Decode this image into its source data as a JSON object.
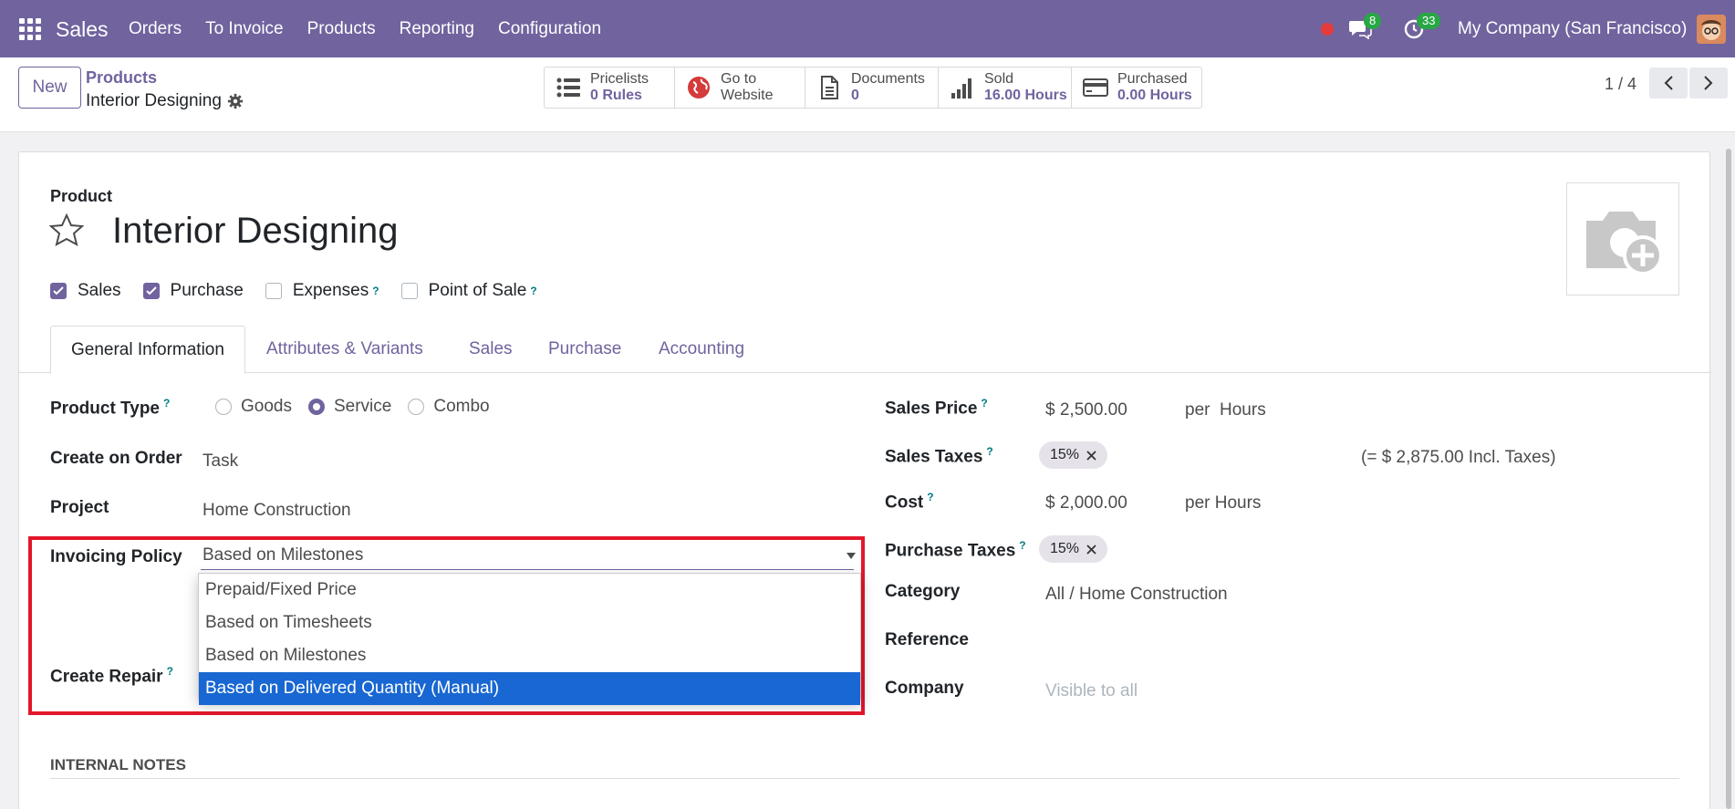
{
  "nav": {
    "app_name": "Sales",
    "menu": [
      "Orders",
      "To Invoice",
      "Products",
      "Reporting",
      "Configuration"
    ],
    "messages_count": "8",
    "activities_count": "33",
    "company": "My Company (San Francisco)"
  },
  "control": {
    "new_label": "New",
    "breadcrumb_parent": "Products",
    "breadcrumb_current": "Interior Designing",
    "smart_buttons": [
      {
        "label": "Pricelists",
        "value": "0 Rules",
        "icon": "list-icon"
      },
      {
        "label": "Go to",
        "value": "Website",
        "icon": "globe-icon"
      },
      {
        "label": "Documents",
        "value": "0",
        "icon": "document-icon"
      },
      {
        "label": "Sold",
        "value": "16.00 Hours",
        "icon": "bar-chart-icon"
      },
      {
        "label": "Purchased",
        "value": "0.00 Hours",
        "icon": "credit-card-icon"
      }
    ],
    "pager": "1 / 4"
  },
  "form": {
    "product_label": "Product",
    "name": "Interior Designing",
    "checkboxes": [
      {
        "label": "Sales",
        "checked": true,
        "help": false
      },
      {
        "label": "Purchase",
        "checked": true,
        "help": false
      },
      {
        "label": "Expenses",
        "checked": false,
        "help": true
      },
      {
        "label": "Point of Sale",
        "checked": false,
        "help": true
      }
    ],
    "tabs": [
      "General Information",
      "Attributes & Variants",
      "Sales",
      "Purchase",
      "Accounting"
    ],
    "left": {
      "product_type_label": "Product Type",
      "product_type_options": [
        "Goods",
        "Service",
        "Combo"
      ],
      "product_type_selected": "Service",
      "create_on_order_label": "Create on Order",
      "create_on_order_value": "Task",
      "project_label": "Project",
      "project_value": "Home Construction",
      "invoicing_policy_label": "Invoicing Policy",
      "invoicing_policy_value": "Based on Milestones",
      "invoicing_policy_options": [
        "Prepaid/Fixed Price",
        "Based on Timesheets",
        "Based on Milestones",
        "Based on Delivered Quantity (Manual)"
      ],
      "invoicing_policy_highlighted": "Based on Delivered Quantity (Manual)",
      "create_repair_label": "Create Repair"
    },
    "right": {
      "sales_price_label": "Sales Price",
      "sales_price_value": "$ 2,500.00",
      "sales_price_uom": "per  Hours",
      "sales_taxes_label": "Sales Taxes",
      "sales_tax_tag": "15%",
      "incl_taxes": "(= $ 2,875.00 Incl. Taxes)",
      "cost_label": "Cost",
      "cost_value": "$ 2,000.00",
      "cost_uom": "per Hours",
      "purchase_taxes_label": "Purchase Taxes",
      "purchase_tax_tag": "15%",
      "category_label": "Category",
      "category_value": "All / Home Construction",
      "reference_label": "Reference",
      "company_label": "Company",
      "company_placeholder": "Visible to all"
    },
    "internal_notes_label": "INTERNAL NOTES"
  },
  "colors": {
    "brand": "#71639e",
    "highlight": "#e3172a",
    "selected_option": "#1967d2"
  }
}
